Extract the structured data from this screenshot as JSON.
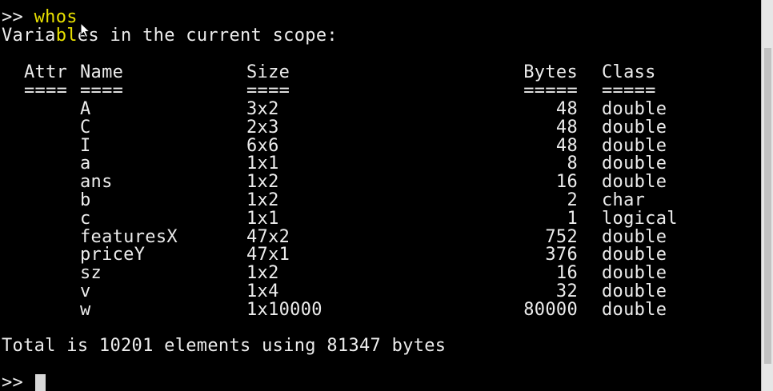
{
  "command_line": {
    "prompt": ">> ",
    "command": "whos"
  },
  "scope_header": {
    "prefix": "Varia",
    "highlight": "bl",
    "suffix": "es in the current scope:"
  },
  "columns": {
    "attr": "Attr",
    "name": "Name",
    "size": "Size",
    "bytes": "Bytes",
    "class": "Class"
  },
  "underlines": {
    "attr": "====",
    "name": "====",
    "size": "====",
    "bytes": "=====",
    "class": "====="
  },
  "variables": [
    {
      "name": "A",
      "size": "3x2",
      "bytes": "48",
      "class": "double"
    },
    {
      "name": "C",
      "size": "2x3",
      "bytes": "48",
      "class": "double"
    },
    {
      "name": "I",
      "size": "6x6",
      "bytes": "48",
      "class": "double"
    },
    {
      "name": "a",
      "size": "1x1",
      "bytes": "8",
      "class": "double"
    },
    {
      "name": "ans",
      "size": "1x2",
      "bytes": "16",
      "class": "double"
    },
    {
      "name": "b",
      "size": "1x2",
      "bytes": "2",
      "class": "char"
    },
    {
      "name": "c",
      "size": "1x1",
      "bytes": "1",
      "class": "logical"
    },
    {
      "name": "featuresX",
      "size": "47x2",
      "bytes": "752",
      "class": "double"
    },
    {
      "name": "priceY",
      "size": "47x1",
      "bytes": "376",
      "class": "double"
    },
    {
      "name": "sz",
      "size": "1x2",
      "bytes": "16",
      "class": "double"
    },
    {
      "name": "v",
      "size": "1x4",
      "bytes": "32",
      "class": "double"
    },
    {
      "name": "w",
      "size": "1x10000",
      "bytes": "80000",
      "class": "double"
    }
  ],
  "total_line": "Total is 10201 elements using 81347 bytes",
  "final_prompt": ">> ",
  "colors": {
    "background": "#000000",
    "text": "#ececec",
    "highlight": "#e8e000"
  }
}
